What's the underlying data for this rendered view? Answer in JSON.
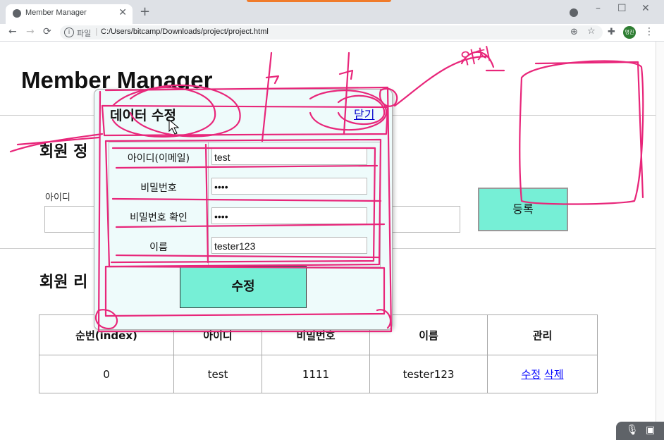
{
  "browser": {
    "tab_title": "Member Manager",
    "new_tab": "+",
    "address_prefix": "파일",
    "url": "C:/Users/bitcamp/Downloads/project/project.html",
    "profile_initials": "명진",
    "window_controls": {
      "minimize": "–",
      "maximize": "☐",
      "close": "✕"
    },
    "nav": {
      "back": "←",
      "forward": "→",
      "reload": "⟳"
    }
  },
  "page": {
    "title": "Member Manager",
    "register_section": {
      "heading": "회원 정",
      "id_label": "아이디",
      "register_button": "등록"
    },
    "list_section": {
      "heading": "회원 리",
      "columns": [
        "순번(index)",
        "아이디",
        "비밀번호",
        "이름",
        "관리"
      ],
      "rows": [
        {
          "index": "0",
          "id": "test",
          "password": "1111",
          "name": "tester123",
          "edit": "수정",
          "delete": "삭제"
        }
      ]
    }
  },
  "modal": {
    "title": "데이터 수정",
    "close_label": "닫기",
    "fields": [
      {
        "label": "아이디(이메일)",
        "value": "test"
      },
      {
        "label": "비밀번호",
        "value": "••••"
      },
      {
        "label": "비밀번호 확인",
        "value": "••••"
      },
      {
        "label": "이름",
        "value": "tester123"
      }
    ],
    "submit_label": "수정"
  },
  "annotation": {
    "text": "위치",
    "color": "#e8267a"
  }
}
